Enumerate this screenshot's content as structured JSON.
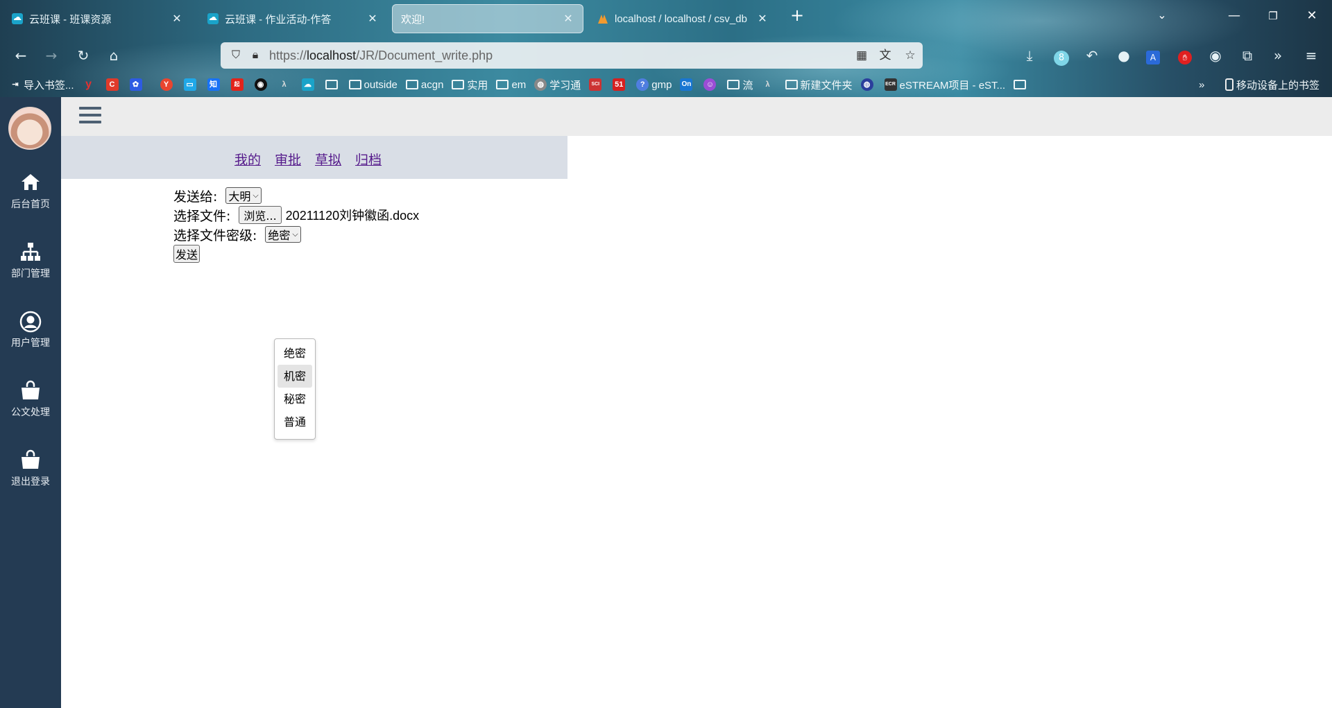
{
  "browser": {
    "tabs": [
      {
        "title": "云班课 - 班课资源",
        "active": false
      },
      {
        "title": "云班课 - 作业活动-作答",
        "active": false
      },
      {
        "title": "欢迎!",
        "active": true
      },
      {
        "title": "localhost / localhost / csv_db",
        "active": false
      }
    ],
    "url_prefix": "https://",
    "url_host": "localhost",
    "url_path": "/JR/Document_write.php",
    "bookmarks": [
      "导入书签...",
      "outside",
      "acgn",
      "实用",
      "em",
      "学习通",
      "gmp",
      "流",
      "新建文件夹",
      "eSTREAM项目 - eST..."
    ],
    "mobile_bookmarks": "移动设备上的书签",
    "badge_count": "8"
  },
  "sidebar": {
    "items": [
      {
        "label": "后台首页",
        "icon": "home-icon"
      },
      {
        "label": "部门管理",
        "icon": "sitemap-icon"
      },
      {
        "label": "用户管理",
        "icon": "user-circle-icon"
      },
      {
        "label": "公文处理",
        "icon": "shopping-bag-icon"
      },
      {
        "label": "退出登录",
        "icon": "shopping-bag-icon"
      }
    ]
  },
  "subnav": {
    "links": [
      "我的",
      "审批",
      "草拟",
      "归档"
    ]
  },
  "form": {
    "send_to_label": "发送给:",
    "send_to_value": "大明",
    "file_label": "选择文件:",
    "browse_label": "浏览...",
    "file_name": "20211120刘钟徽函.docx",
    "secrecy_label": "选择文件密级:",
    "secrecy_value": "绝密",
    "submit_label": "发送"
  },
  "secrecy_dropdown": {
    "options": [
      "绝密",
      "机密",
      "秘密",
      "普通"
    ],
    "highlighted": "机密"
  }
}
